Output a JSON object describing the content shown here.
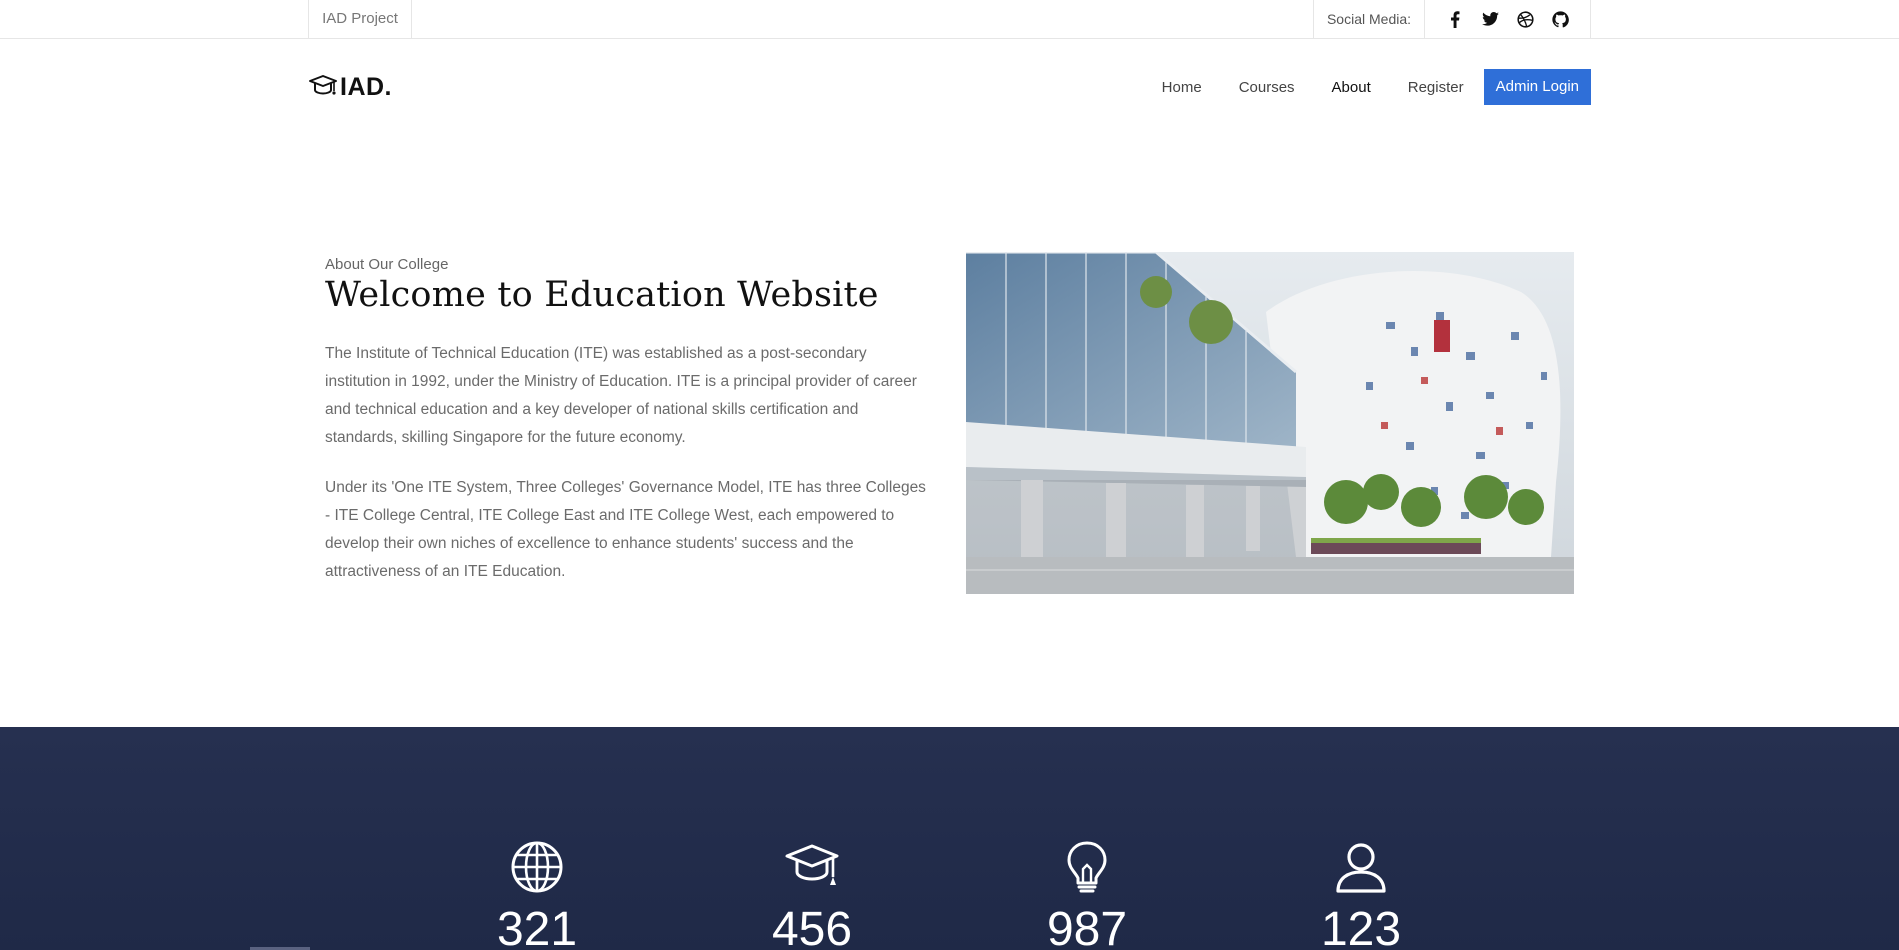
{
  "topbar": {
    "project": "IAD Project",
    "social_label": "Social Media:",
    "social_icons": [
      "facebook-icon",
      "twitter-icon",
      "dribbble-icon",
      "github-icon"
    ]
  },
  "header": {
    "logo_text": "IAD.",
    "nav": [
      "Home",
      "Courses",
      "About",
      "Register"
    ],
    "active_nav": "About",
    "admin_button": "Admin Login"
  },
  "about": {
    "subtitle": "About Our College",
    "title": "Welcome to Education Website",
    "p1": "The Institute of Technical Education (ITE) was established as a post-secondary institution in 1992, under the Ministry of Education. ITE is a principal provider of career and technical education and a key developer of national skills certification and standards, skilling Singapore for the future economy.",
    "p2": "Under its 'One ITE System, Three Colleges' Governance Model, ITE has three Colleges - ITE College Central, ITE College East and ITE College West, each empowered to develop their own niches of excellence to enhance students' success and the attractiveness of an ITE Education."
  },
  "stats": [
    {
      "icon": "globe-icon",
      "value": "321"
    },
    {
      "icon": "graduation-cap-icon",
      "value": "456"
    },
    {
      "icon": "lightbulb-icon",
      "value": "987"
    },
    {
      "icon": "user-icon",
      "value": "123"
    }
  ],
  "colors": {
    "accent": "#2f6fd8",
    "stats_bg": "#232c4b"
  }
}
